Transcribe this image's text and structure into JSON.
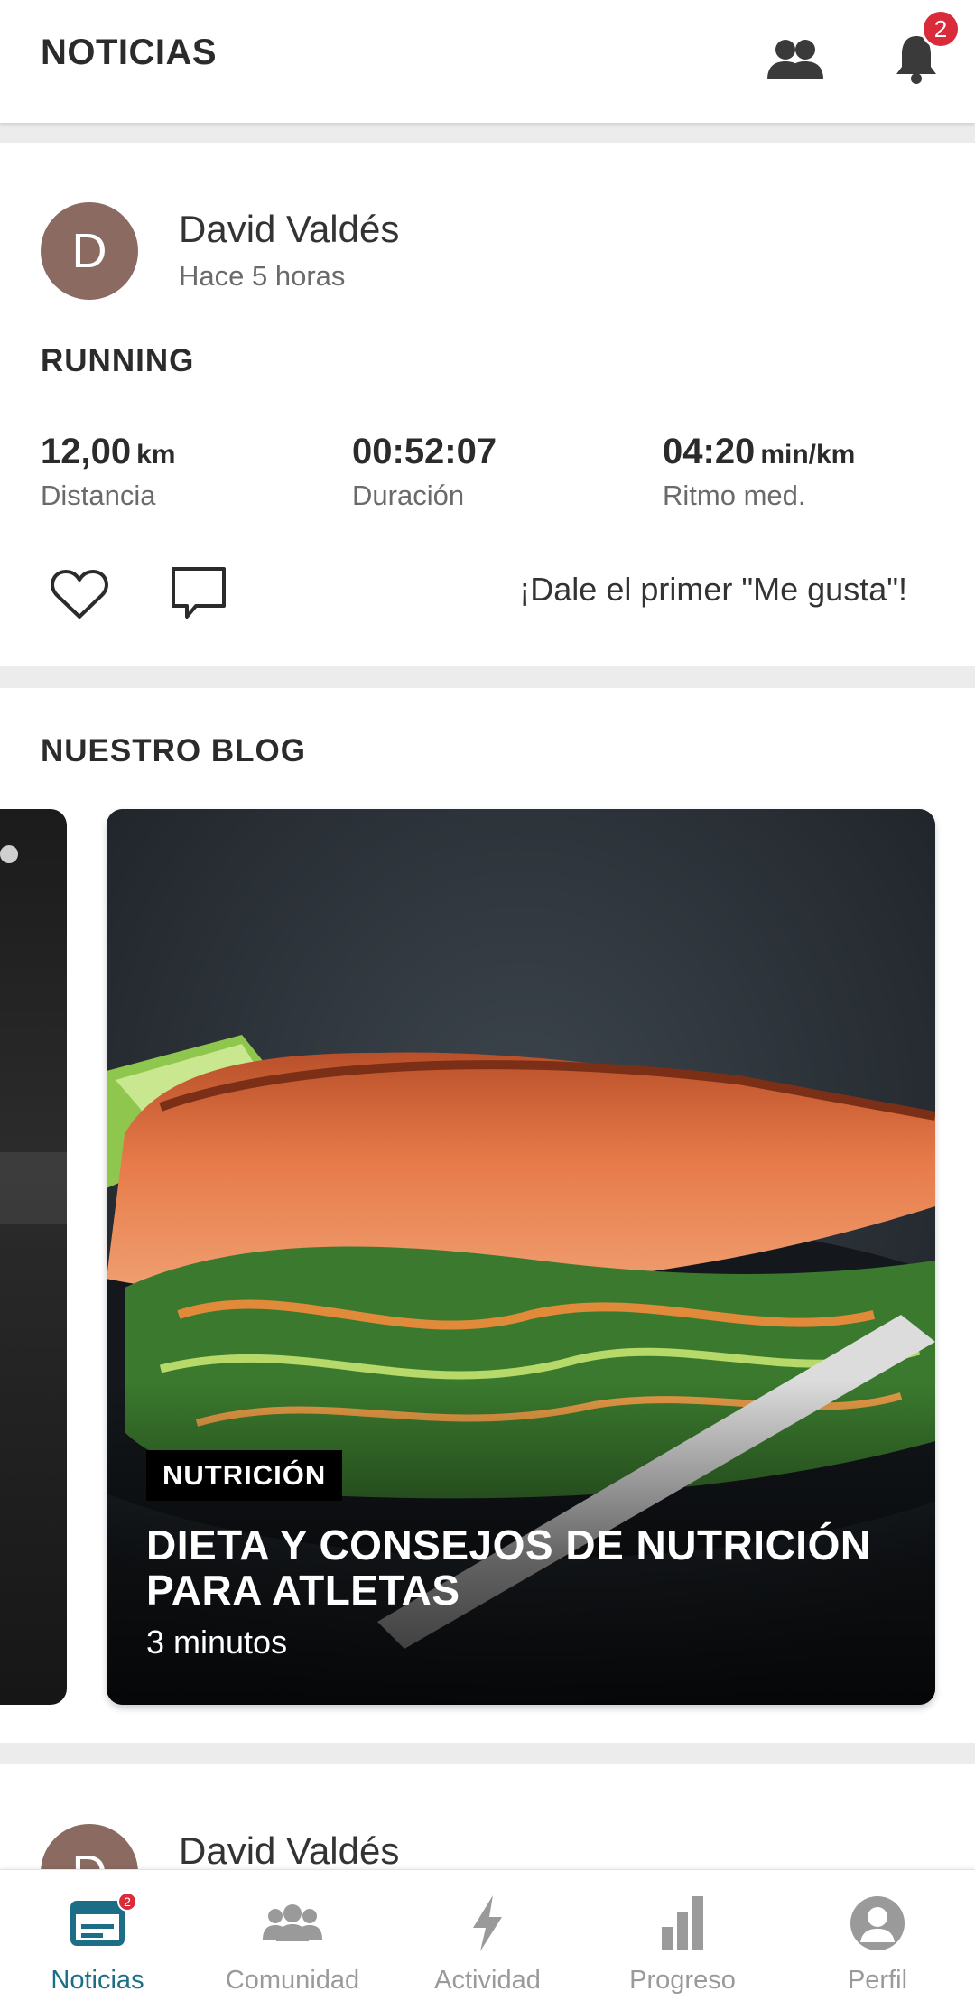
{
  "header": {
    "title": "NOTICIAS",
    "notification_count": "2",
    "icons": {
      "friends": "friends-icon",
      "notifications": "bell-icon"
    }
  },
  "feed": {
    "post1": {
      "avatar_letter": "D",
      "author": "David Valdés",
      "time": "Hace 5 horas",
      "activity": "RUNNING",
      "stats": [
        {
          "value": "12,00",
          "unit": "km",
          "label": "Distancia"
        },
        {
          "value": "00:52:07",
          "unit": "",
          "label": "Duración"
        },
        {
          "value": "04:20",
          "unit": "min/km",
          "label": "Ritmo med."
        }
      ],
      "like_prompt": "¡Dale el primer \"Me gusta\"!"
    },
    "blog": {
      "section_title": "NUESTRO BLOG",
      "article": {
        "category": "NUTRICIÓN",
        "title": "DIETA Y CONSEJOS DE NUTRICIÓN PARA ATLETAS",
        "read_time": "3 minutos"
      }
    },
    "post2": {
      "avatar_letter": "D",
      "author": "David Valdés"
    }
  },
  "bottom_nav": {
    "items": [
      {
        "label": "Noticias",
        "icon": "news-icon",
        "badge": "2",
        "active": true
      },
      {
        "label": "Comunidad",
        "icon": "community-icon",
        "active": false
      },
      {
        "label": "Actividad",
        "icon": "bolt-icon",
        "active": false
      },
      {
        "label": "Progreso",
        "icon": "bar-chart-icon",
        "active": false
      },
      {
        "label": "Perfil",
        "icon": "profile-icon",
        "active": false
      }
    ]
  },
  "colors": {
    "accent": "#1b6e86",
    "badge": "#d92b3a",
    "avatar": "#8b6a61",
    "inactive": "#9a9a9a"
  }
}
